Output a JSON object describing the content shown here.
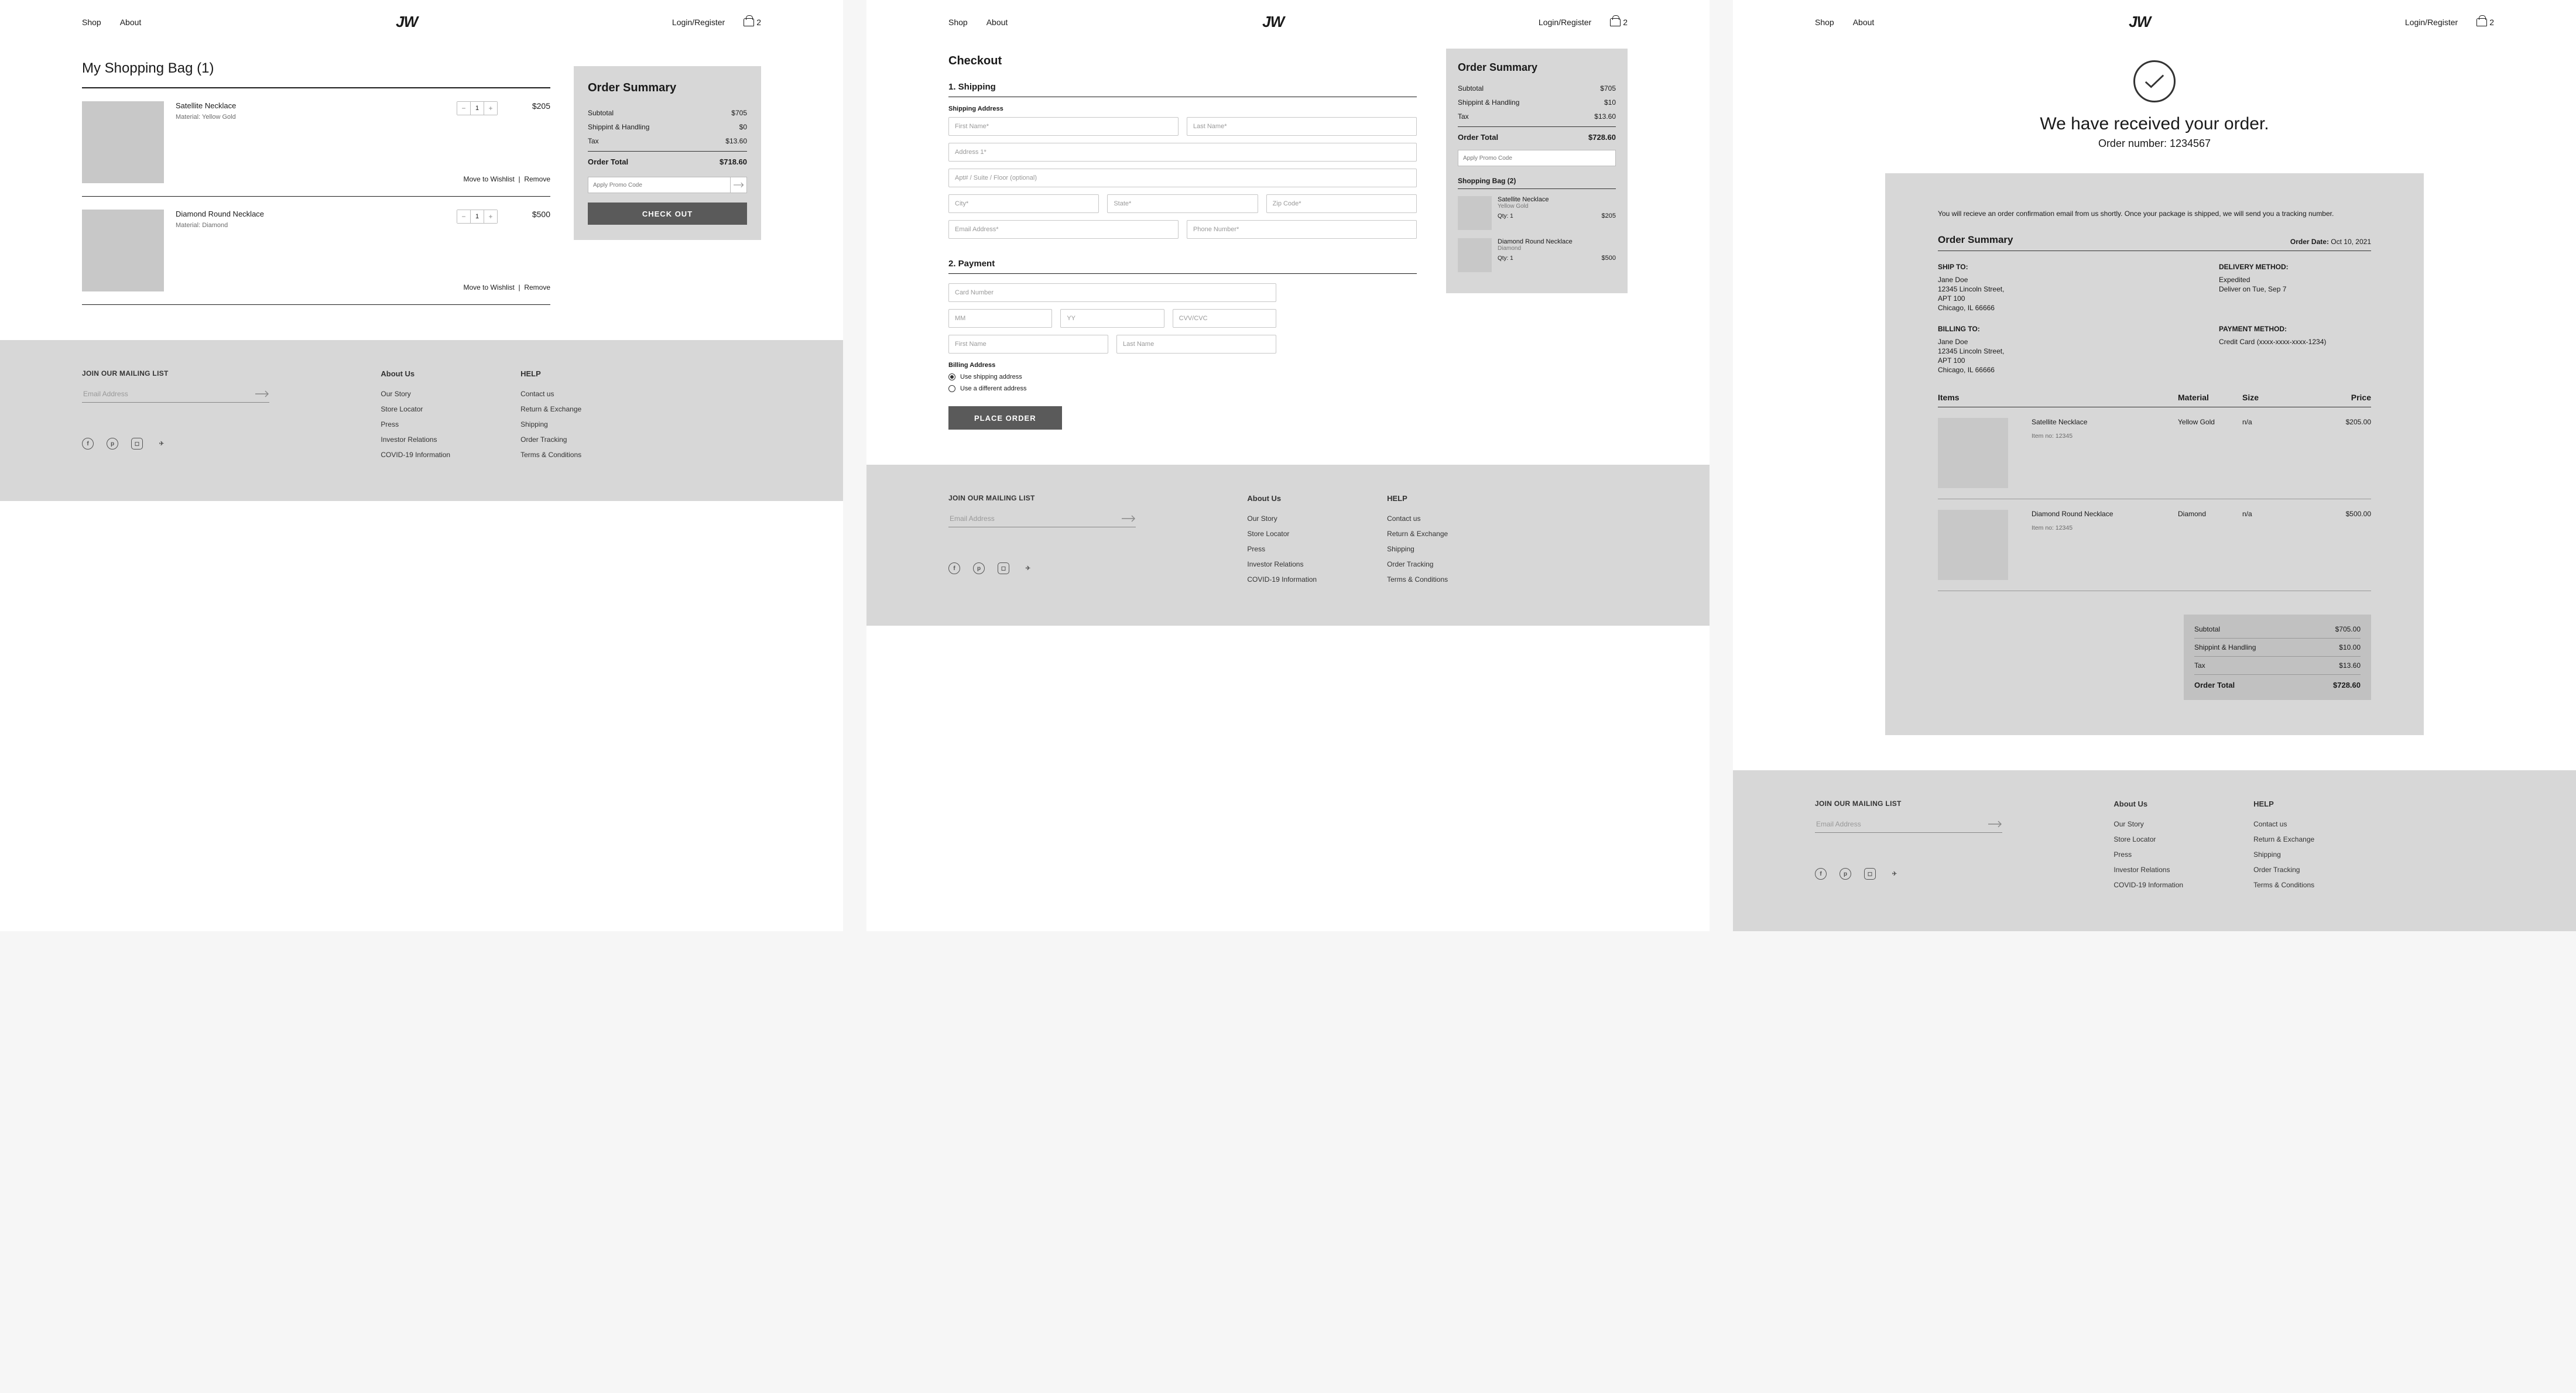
{
  "nav": {
    "shop": "Shop",
    "about": "About",
    "logo": "JW",
    "login": "Login/Register",
    "bag_count": "2"
  },
  "footer": {
    "mailing_title": "JOIN OUR MAILING LIST",
    "email_placeholder": "Email Address",
    "about_title": "About Us",
    "about_links": [
      "Our Story",
      "Store Locator",
      "Press",
      "Investor Relations",
      "COVID-19 Information"
    ],
    "help_title": "HELP",
    "help_links": [
      "Contact us",
      "Return & Exchange",
      "Shipping",
      "Order Tracking",
      "Terms & Conditions"
    ]
  },
  "cart": {
    "title": "My Shopping Bag (1)",
    "items": [
      {
        "name": "Satellite Necklace",
        "material": "Material: Yellow Gold",
        "qty": "1",
        "price": "$205"
      },
      {
        "name": "Diamond Round Necklace",
        "material": "Material: Diamond",
        "qty": "1",
        "price": "$500"
      }
    ],
    "wishlist": "Move to Wishlist",
    "remove": "Remove",
    "summary": {
      "title": "Order Summary",
      "subtotal_label": "Subtotal",
      "subtotal": "$705",
      "ship_label": "Shippint & Handling",
      "ship": "$0",
      "tax_label": "Tax",
      "tax": "$13.60",
      "total_label": "Order Total",
      "total": "$718.60",
      "promo_placeholder": "Apply Promo Code",
      "checkout": "CHECK OUT"
    }
  },
  "checkout": {
    "title": "Checkout",
    "step1": "1. Shipping",
    "addr_label": "Shipping Address",
    "ph": {
      "first": "First Name*",
      "last": "Last Name*",
      "addr1": "Address 1*",
      "addr2": "Apt# / Suite / Floor (optional)",
      "city": "City*",
      "state": "State*",
      "zip": "Zip Code*",
      "email": "Email Address*",
      "phone": "Phone Number*"
    },
    "step2": "2. Payment",
    "pay": {
      "card": "Card Number",
      "mm": "MM",
      "yy": "YY",
      "cvv": "CVV/CVC",
      "first": "First Name",
      "last": "Last Name"
    },
    "billing_label": "Billing Address",
    "radio1": "Use shipping address",
    "radio2": "Use a different address",
    "place_order": "PLACE ORDER",
    "summary": {
      "title": "Order Summary",
      "subtotal_label": "Subtotal",
      "subtotal": "$705",
      "ship_label": "Shippint & Handling",
      "ship": "$10",
      "tax_label": "Tax",
      "tax": "$13.60",
      "total_label": "Order Total",
      "total": "$728.60",
      "promo_placeholder": "Apply Promo Code",
      "bag_head": "Shopping Bag (2)",
      "items": [
        {
          "name": "Satellite Necklace",
          "material": "Yellow Gold",
          "qty": "Qty: 1",
          "price": "$205"
        },
        {
          "name": "Diamond Round Necklace",
          "material": "Diamond",
          "qty": "Qty: 1",
          "price": "$500"
        }
      ]
    }
  },
  "confirm": {
    "heading": "We have received your order.",
    "order_num": "Order number: 1234567",
    "note": "You will recieve an order confirmation email from us shortly. Once your package is shipped, we will send you a tracking number.",
    "os_title": "Order Summary",
    "date_label": "Order Date:",
    "date": " Oct 10, 2021",
    "shipto": {
      "label": "SHIP TO:",
      "lines": [
        "Jane Doe",
        "12345 Lincoln Street,",
        "APT 100",
        "Chicago, IL 66666"
      ]
    },
    "delivery": {
      "label": "DELIVERY METHOD:",
      "lines": [
        "Expedited",
        "Deliver on Tue, Sep 7"
      ]
    },
    "billto": {
      "label": "BILLING TO:",
      "lines": [
        "Jane Doe",
        "12345 Lincoln Street,",
        "APT 100",
        "Chicago, IL 66666"
      ]
    },
    "payment": {
      "label": "PAYMENT METHOD:",
      "lines": [
        "Credit Card (xxxx-xxxx-xxxx-1234)"
      ]
    },
    "cols": {
      "items": "Items",
      "material": "Material",
      "size": "Size",
      "price": "Price"
    },
    "items": [
      {
        "name": "Satellite Necklace",
        "no": "Item no: 12345",
        "material": "Yellow Gold",
        "size": "n/a",
        "price": "$205.00"
      },
      {
        "name": "Diamond Round Necklace",
        "no": "Item no: 12345",
        "material": "Diamond",
        "size": "n/a",
        "price": "$500.00"
      }
    ],
    "totals": {
      "subtotal_label": "Subtotal",
      "subtotal": "$705.00",
      "ship_label": "Shippint & Handling",
      "ship": "$10.00",
      "tax_label": "Tax",
      "tax": "$13.60",
      "total_label": "Order Total",
      "total": "$728.60"
    }
  }
}
